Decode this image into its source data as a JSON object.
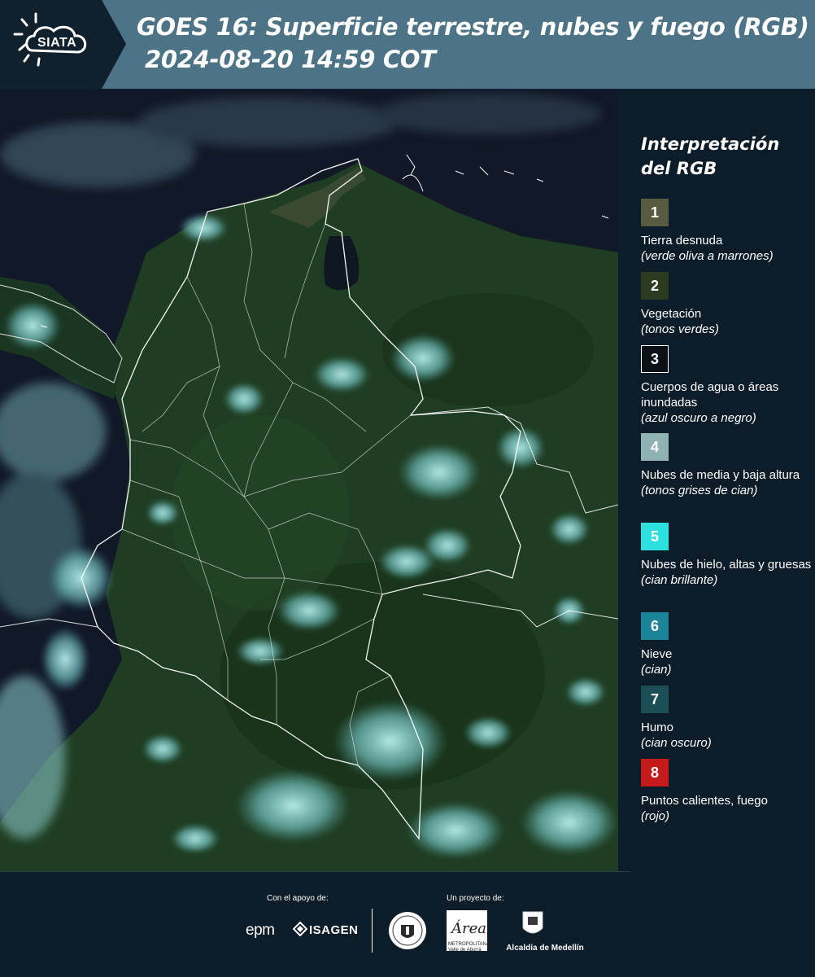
{
  "header": {
    "logo_text": "SIATA",
    "title_line1": "GOES 16: Superficie terrestre, nubes y fuego (RGB)",
    "title_line2": "2024-08-20 14:59 COT"
  },
  "map": {
    "description_icon": "satellite-rgb-map",
    "colors": {
      "ocean": "#111827",
      "land": "#1f3d22",
      "cloud": "#7fd4d6",
      "borders": "#ffffff"
    }
  },
  "legend": {
    "title": "Interpretación del RGB",
    "items": [
      {
        "number": "1",
        "label": "Tierra desnuda",
        "sub": "(verde oliva a marrones)",
        "color": "#5a5a40"
      },
      {
        "number": "2",
        "label": "Vegetación",
        "sub": "(tonos verdes)",
        "color": "#2b3b1f"
      },
      {
        "number": "3",
        "label": "Cuerpos de agua o áreas inundadas",
        "sub": "(azul oscuro a negro)",
        "color": "#0c1017"
      },
      {
        "number": "4",
        "label": "Nubes de media y baja altura",
        "sub": "(tonos grises de cian)",
        "color": "#8fb3b3"
      },
      {
        "number": "5",
        "label": "Nubes de hielo, altas y gruesas",
        "sub": "(cian brillante)",
        "color": "#2ce0e0"
      },
      {
        "number": "6",
        "label": "Nieve",
        "sub": "(cian)",
        "color": "#1d8399"
      },
      {
        "number": "7",
        "label": "Humo",
        "sub": "(cian oscuro)",
        "color": "#1c4f55"
      },
      {
        "number": "8",
        "label": "Puntos calientes, fuego",
        "sub": "(rojo)",
        "color": "#c41a1a"
      }
    ]
  },
  "footer": {
    "support_label": "Con el apoyo de:",
    "project_label": "Un proyecto de:",
    "sponsor_1": "epm",
    "sponsor_2": "ISAGEN",
    "area_logo_text": "Área",
    "area_caption": "METROPOLITANA Valle de Aburrá",
    "alcaldia": "Alcaldía de Medellín"
  }
}
